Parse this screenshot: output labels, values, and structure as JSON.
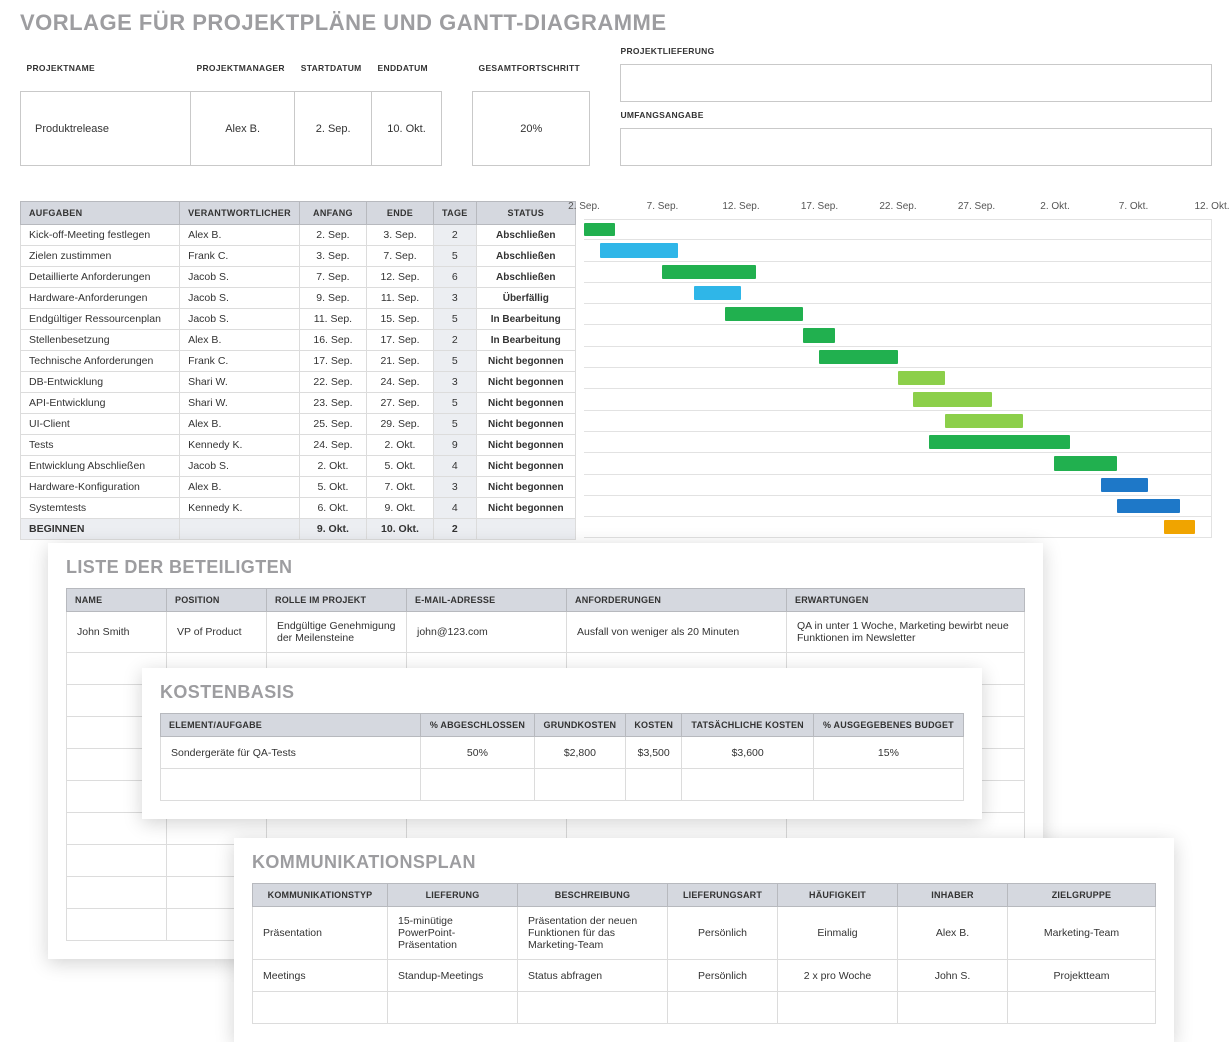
{
  "title": "VORLAGE FÜR PROJEKTPLÄNE UND GANTT-DIAGRAMME",
  "labels": {
    "projectName": "PROJEKTNAME",
    "projectManager": "PROJEKTMANAGER",
    "startDate": "STARTDATUM",
    "endDate": "ENDDATUM",
    "overallProgress": "GESAMTFORTSCHRITT",
    "delivery": "PROJEKTLIEFERUNG",
    "scope": "UMFANGSANGABE"
  },
  "project": {
    "name": "Produktrelease",
    "manager": "Alex B.",
    "start": "2. Sep.",
    "end": "10. Okt.",
    "progress": "20%"
  },
  "taskHeaders": {
    "task": "AUFGABEN",
    "owner": "VERANTWORTLICHER",
    "start": "ANFANG",
    "end": "ENDE",
    "days": "TAGE",
    "status": "STATUS"
  },
  "chart_data": {
    "type": "gantt",
    "xlabels": [
      "2. Sep.",
      "7. Sep.",
      "12. Sep.",
      "17. Sep.",
      "22. Sep.",
      "27. Sep.",
      "2. Okt.",
      "7. Okt.",
      "12. Okt."
    ],
    "xrange": [
      0,
      40
    ],
    "xticks": [
      0,
      5,
      10,
      15,
      20,
      25,
      30,
      35,
      40
    ],
    "rows": [
      {
        "task": "Kick-off-Meeting festlegen",
        "owner": "Alex B.",
        "start": "2. Sep.",
        "end": "3. Sep.",
        "days": 2,
        "status": "Abschließen",
        "bar_start": 0,
        "bar_len": 2,
        "color": "#21b04f"
      },
      {
        "task": "Zielen zustimmen",
        "owner": "Frank C.",
        "start": "3. Sep.",
        "end": "7. Sep.",
        "days": 5,
        "status": "Abschließen",
        "bar_start": 1,
        "bar_len": 5,
        "color": "#2fb6e8"
      },
      {
        "task": "Detaillierte Anforderungen",
        "owner": "Jacob S.",
        "start": "7. Sep.",
        "end": "12. Sep.",
        "days": 6,
        "status": "Abschließen",
        "bar_start": 5,
        "bar_len": 6,
        "color": "#21b04f"
      },
      {
        "task": "Hardware-Anforderungen",
        "owner": "Jacob S.",
        "start": "9. Sep.",
        "end": "11. Sep.",
        "days": 3,
        "status": "Überfällig",
        "bar_start": 7,
        "bar_len": 3,
        "color": "#2fb6e8"
      },
      {
        "task": "Endgültiger Ressourcenplan",
        "owner": "Jacob S.",
        "start": "11. Sep.",
        "end": "15. Sep.",
        "days": 5,
        "status": "In Bearbeitung",
        "bar_start": 9,
        "bar_len": 5,
        "color": "#21b04f"
      },
      {
        "task": "Stellenbesetzung",
        "owner": "Alex B.",
        "start": "16. Sep.",
        "end": "17. Sep.",
        "days": 2,
        "status": "In Bearbeitung",
        "bar_start": 14,
        "bar_len": 2,
        "color": "#21b04f"
      },
      {
        "task": "Technische Anforderungen",
        "owner": "Frank C.",
        "start": "17. Sep.",
        "end": "21. Sep.",
        "days": 5,
        "status": "Nicht begonnen",
        "bar_start": 15,
        "bar_len": 5,
        "color": "#21b04f"
      },
      {
        "task": "DB-Entwicklung",
        "owner": "Shari W.",
        "start": "22. Sep.",
        "end": "24. Sep.",
        "days": 3,
        "status": "Nicht begonnen",
        "bar_start": 20,
        "bar_len": 3,
        "color": "#8ccf4a"
      },
      {
        "task": "API-Entwicklung",
        "owner": "Shari W.",
        "start": "23. Sep.",
        "end": "27. Sep.",
        "days": 5,
        "status": "Nicht begonnen",
        "bar_start": 21,
        "bar_len": 5,
        "color": "#8ccf4a"
      },
      {
        "task": "UI-Client",
        "owner": "Alex B.",
        "start": "25. Sep.",
        "end": "29. Sep.",
        "days": 5,
        "status": "Nicht begonnen",
        "bar_start": 23,
        "bar_len": 5,
        "color": "#8ccf4a"
      },
      {
        "task": "Tests",
        "owner": "Kennedy K.",
        "start": "24. Sep.",
        "end": "2. Okt.",
        "days": 9,
        "status": "Nicht begonnen",
        "bar_start": 22,
        "bar_len": 9,
        "color": "#21b04f"
      },
      {
        "task": "Entwicklung Abschließen",
        "owner": "Jacob S.",
        "start": "2. Okt.",
        "end": "5. Okt.",
        "days": 4,
        "status": "Nicht begonnen",
        "bar_start": 30,
        "bar_len": 4,
        "color": "#21b04f"
      },
      {
        "task": "Hardware-Konfiguration",
        "owner": "Alex B.",
        "start": "5. Okt.",
        "end": "7. Okt.",
        "days": 3,
        "status": "Nicht begonnen",
        "bar_start": 33,
        "bar_len": 3,
        "color": "#1e78c8"
      },
      {
        "task": "Systemtests",
        "owner": "Kennedy K.",
        "start": "6. Okt.",
        "end": "9. Okt.",
        "days": 4,
        "status": "Nicht begonnen",
        "bar_start": 34,
        "bar_len": 4,
        "color": "#1e78c8"
      }
    ],
    "summary": {
      "label": "BEGINNEN",
      "start": "9. Okt.",
      "end": "10. Okt.",
      "days": 2,
      "bar_start": 37,
      "bar_len": 2,
      "color": "#f0a400"
    }
  },
  "stakeholders": {
    "title": "LISTE DER BETEILIGTEN",
    "headers": {
      "name": "NAME",
      "position": "POSITION",
      "role": "ROLLE IM PROJEKT",
      "email": "E-MAIL-ADRESSE",
      "req": "ANFORDERUNGEN",
      "exp": "ERWARTUNGEN"
    },
    "rows": [
      {
        "name": "John Smith",
        "position": "VP of Product",
        "role": "Endgültige Genehmigung der Meilensteine",
        "email": "john@123.com",
        "req": "Ausfall von weniger als 20 Minuten",
        "exp": "QA in unter 1 Woche, Marketing bewirbt neue Funktionen im Newsletter"
      }
    ]
  },
  "cost": {
    "title": "KOSTENBASIS",
    "headers": {
      "item": "ELEMENT/AUFGABE",
      "pct": "% ABGESCHLOSSEN",
      "base": "GRUNDKOSTEN",
      "cost": "KOSTEN",
      "actual": "TATSÄCHLICHE KOSTEN",
      "budget": "% AUSGEGEBENES BUDGET"
    },
    "rows": [
      {
        "item": "Sondergeräte für QA-Tests",
        "pct": "50%",
        "base": "$2,800",
        "cost": "$3,500",
        "actual": "$3,600",
        "budget": "15%"
      }
    ]
  },
  "comm": {
    "title": "KOMMUNIKATIONSPLAN",
    "headers": {
      "type": "KOMMUNIKATIONSTYP",
      "deliv": "LIEFERUNG",
      "desc": "BESCHREIBUNG",
      "mode": "LIEFERUNGSART",
      "freq": "HÄUFIGKEIT",
      "owner": "INHABER",
      "aud": "ZIELGRUPPE"
    },
    "rows": [
      {
        "type": "Präsentation",
        "deliv": "15-minütige PowerPoint-Präsentation",
        "desc": "Präsentation der neuen Funktionen für das Marketing-Team",
        "mode": "Persönlich",
        "freq": "Einmalig",
        "owner": "Alex B.",
        "aud": "Marketing-Team"
      },
      {
        "type": "Meetings",
        "deliv": "Standup-Meetings",
        "desc": "Status abfragen",
        "mode": "Persönlich",
        "freq": "2 x pro Woche",
        "owner": "John S.",
        "aud": "Projektteam"
      }
    ]
  }
}
